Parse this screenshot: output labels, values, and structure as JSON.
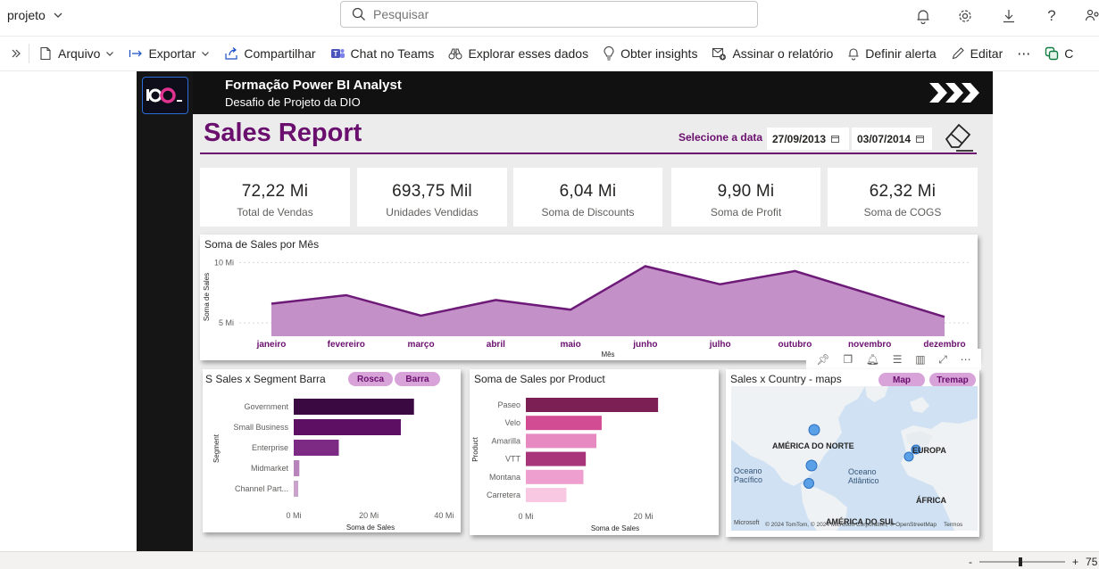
{
  "topbar": {
    "workspace": "projeto",
    "search_placeholder": "Pesquisar",
    "icons": [
      "bell-icon",
      "gear-icon",
      "download-icon",
      "help-icon",
      "share-icon"
    ]
  },
  "commandbar": {
    "items": [
      {
        "label": "Arquivo",
        "icon": "file-icon"
      },
      {
        "label": "Exportar",
        "icon": "export-icon"
      },
      {
        "label": "Compartilhar",
        "icon": "share-icon"
      },
      {
        "label": "Chat no Teams",
        "icon": "teams-icon"
      },
      {
        "label": "Explorar esses dados",
        "icon": "binoculars-icon"
      },
      {
        "label": "Obter insights",
        "icon": "lightbulb-icon"
      },
      {
        "label": "Assinar o relatório",
        "icon": "subscribe-icon"
      },
      {
        "label": "Definir alerta",
        "icon": "bell-icon"
      },
      {
        "label": "Editar",
        "icon": "pencil-icon"
      },
      {
        "label": "C",
        "icon": "copilot-icon"
      }
    ],
    "more": "⋯"
  },
  "report": {
    "header_title": "Formação Power BI Analyst",
    "header_subtitle": "Desafio de Projeto da DIO",
    "title": "Sales Report",
    "date_label": "Selecione a data",
    "date_start": "27/09/2013",
    "date_end": "03/07/2014",
    "kpis": [
      {
        "value": "72,22 Mi",
        "label": "Total de Vendas"
      },
      {
        "value": "693,75 Mil",
        "label": "Unidades Vendidas"
      },
      {
        "value": "6,04 Mi",
        "label": "Soma de Discounts"
      },
      {
        "value": "9,90 Mi",
        "label": "Soma de Profit"
      },
      {
        "value": "62,32 Mi",
        "label": "Soma de COGS"
      }
    ],
    "area_title": "Soma de Sales por Mês",
    "segment_title": "S Sales x Segment Barra",
    "segment_pills": [
      "Rosca",
      "Barra"
    ],
    "product_title": "Soma de Sales por Product",
    "map_title": "Sales x Country - maps",
    "map_pills": [
      "Map",
      "Tremap"
    ],
    "map_labels": {
      "na": "AMÉRICA DO NORTE",
      "europe": "EUROPA",
      "pacific": "Oceano Pacífico",
      "atlantic": "Oceano Atlântico",
      "africa": "ÁFRICA",
      "sa": "AMÉRICA DO SUL",
      "attribution": "© 2024 TomTom, © 2024 Microsoft Corporation, © OpenStreetMap",
      "terms": "Termos",
      "brand": "Microsoft"
    }
  },
  "zoom": {
    "minus": "-",
    "plus": "+",
    "value": "75"
  },
  "colors": {
    "accent": "#6a0f6e",
    "area_fill": "#c08ac4",
    "area_line": "#6e1a78"
  },
  "chart_data": [
    {
      "type": "area",
      "title": "Soma de Sales por Mês",
      "xlabel": "Mês",
      "ylabel": "Soma de Sales",
      "categories": [
        "janeiro",
        "fevereiro",
        "março",
        "abril",
        "maio",
        "junho",
        "julho",
        "outubro",
        "novembro",
        "dezembro"
      ],
      "values": [
        6.6,
        7.3,
        5.6,
        6.9,
        6.1,
        9.7,
        8.2,
        9.3,
        7.4,
        5.5
      ],
      "ytick_labels": [
        "5 Mi",
        "10 Mi"
      ],
      "ytick_values": [
        5,
        10
      ],
      "ylim": [
        3.9,
        10.4
      ],
      "grid": true
    },
    {
      "type": "bar",
      "orientation": "horizontal",
      "title": "S Sales x Segment Barra",
      "xlabel": "Soma de Sales",
      "ylabel": "Segment",
      "categories": [
        "Government",
        "Small Business",
        "Enterprise",
        "Midmarket",
        "Channel Part..."
      ],
      "values": [
        32,
        28.5,
        12,
        1.5,
        1.2
      ],
      "colors": [
        "#3b0942",
        "#5c0f63",
        "#7d2a84",
        "#b784bb",
        "#c9a3cc"
      ],
      "xtick_labels": [
        "0 Mi",
        "20 Mi",
        "40 Mi"
      ],
      "xtick_values": [
        0,
        20,
        40
      ],
      "xlim": [
        0,
        43
      ]
    },
    {
      "type": "bar",
      "orientation": "horizontal",
      "title": "Soma de Sales por Product",
      "xlabel": "Soma de Sales",
      "ylabel": "Product",
      "categories": [
        "Paseo",
        "Velo",
        "Amarilla",
        "VTT",
        "Montana",
        "Carretera"
      ],
      "values": [
        22.5,
        12.9,
        12,
        10.2,
        9.8,
        6.9
      ],
      "colors": [
        "#7b1f55",
        "#d14c92",
        "#e88ac2",
        "#a8357a",
        "#ef9fcf",
        "#f8c7e2"
      ],
      "xtick_labels": [
        "0 Mi",
        "20 Mi"
      ],
      "xtick_values": [
        0,
        20
      ],
      "xlim": [
        0,
        24
      ]
    }
  ]
}
